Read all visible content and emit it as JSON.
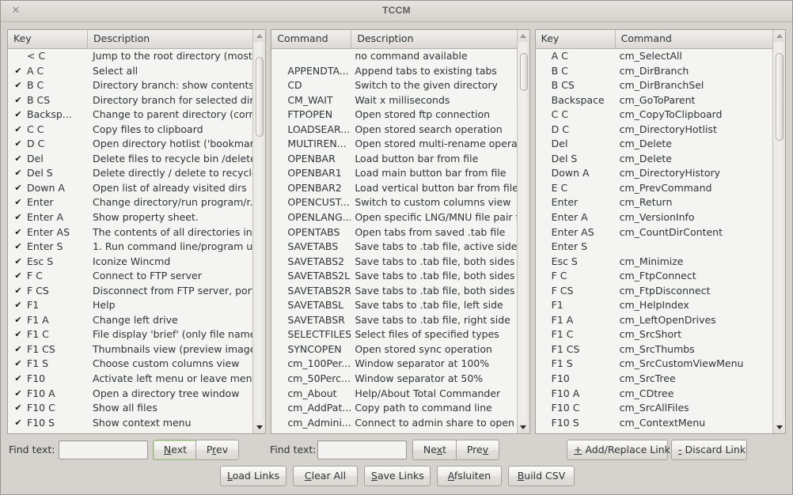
{
  "window": {
    "title": "TCCM",
    "close_icon": "close-icon",
    "close_glyph": "✕"
  },
  "panel_left": {
    "columns": [
      "Key",
      "Description"
    ],
    "scrollbar": {
      "up_icon": "triangle-up-icon",
      "down_icon": "triangle-down-icon",
      "thumb_top_pct": 4,
      "thumb_height_pct": 21
    },
    "rows": [
      {
        "checked": false,
        "key": "< C",
        "desc": "Jump to the root directory (most ..."
      },
      {
        "checked": true,
        "key": "A C",
        "desc": "Select all"
      },
      {
        "checked": true,
        "key": "B C",
        "desc": "Directory branch: show contents ..."
      },
      {
        "checked": true,
        "key": "B CS",
        "desc": "Directory branch for selected dire..."
      },
      {
        "checked": true,
        "key": "Backsp...",
        "desc": "Change to parent directory (corre..."
      },
      {
        "checked": true,
        "key": "C C",
        "desc": "Copy files to clipboard"
      },
      {
        "checked": true,
        "key": "D C",
        "desc": "Open directory hotlist ('bookmark..."
      },
      {
        "checked": true,
        "key": "Del",
        "desc": "Delete files to recycle bin /delete ..."
      },
      {
        "checked": true,
        "key": "Del S",
        "desc": "Delete directly / delete to recycle ..."
      },
      {
        "checked": true,
        "key": "Down A",
        "desc": "Open list of already visited dirs"
      },
      {
        "checked": true,
        "key": "Enter",
        "desc": "Change directory/run program/r..."
      },
      {
        "checked": true,
        "key": "Enter A",
        "desc": "Show property sheet."
      },
      {
        "checked": true,
        "key": "Enter AS",
        "desc": "The contents of all directories in t..."
      },
      {
        "checked": true,
        "key": "Enter S",
        "desc": "1. Run command line/program u..."
      },
      {
        "checked": true,
        "key": "Esc S",
        "desc": "Iconize Wincmd"
      },
      {
        "checked": true,
        "key": "F C",
        "desc": "Connect to FTP server"
      },
      {
        "checked": true,
        "key": "F CS",
        "desc": "Disconnect from FTP server, port ..."
      },
      {
        "checked": true,
        "key": "F1",
        "desc": "Help"
      },
      {
        "checked": true,
        "key": "F1 A",
        "desc": "Change left drive"
      },
      {
        "checked": true,
        "key": "F1 C",
        "desc": "File display 'brief' (only file names)"
      },
      {
        "checked": true,
        "key": "F1 CS",
        "desc": "Thumbnails view (preview images)"
      },
      {
        "checked": true,
        "key": "F1 S",
        "desc": "Choose custom columns view"
      },
      {
        "checked": true,
        "key": "F10",
        "desc": "Activate left menu or leave menu"
      },
      {
        "checked": true,
        "key": "F10 A",
        "desc": "Open a directory tree window"
      },
      {
        "checked": true,
        "key": "F10 C",
        "desc": "Show all files"
      },
      {
        "checked": true,
        "key": "F10 S",
        "desc": "Show context menu"
      }
    ]
  },
  "panel_middle": {
    "columns": [
      "Command",
      "Description"
    ],
    "scrollbar": {
      "up_icon": "triangle-up-icon",
      "down_icon": "triangle-down-icon",
      "thumb_top_pct": 3,
      "thumb_height_pct": 10
    },
    "rows": [
      {
        "cmd": "",
        "desc": "no command available"
      },
      {
        "cmd": "APPENDTA...",
        "desc": "Append tabs to existing tabs"
      },
      {
        "cmd": "CD",
        "desc": "Switch to the given directory"
      },
      {
        "cmd": "CM_WAIT",
        "desc": "Wait x milliseconds"
      },
      {
        "cmd": "FTPOPEN",
        "desc": "Open stored ftp connection"
      },
      {
        "cmd": "LOADSEAR...",
        "desc": "Open stored search operation"
      },
      {
        "cmd": "MULTIREN...",
        "desc": "Open stored multi-rename opera..."
      },
      {
        "cmd": "OPENBAR",
        "desc": "Load button bar from file"
      },
      {
        "cmd": "OPENBAR1",
        "desc": "Load main button bar from file"
      },
      {
        "cmd": "OPENBAR2",
        "desc": "Load vertical button bar from file"
      },
      {
        "cmd": "OPENCUST...",
        "desc": "Switch to custom columns view"
      },
      {
        "cmd": "OPENLANG...",
        "desc": "Open specific LNG/MNU file pair f..."
      },
      {
        "cmd": "OPENTABS",
        "desc": "Open tabs from saved .tab file"
      },
      {
        "cmd": "SAVETABS",
        "desc": "Save tabs to .tab file, active side"
      },
      {
        "cmd": "SAVETABS2",
        "desc": "Save tabs to .tab file, both sides (..."
      },
      {
        "cmd": "SAVETABS2L",
        "desc": "Save tabs to .tab file, both sides (l..."
      },
      {
        "cmd": "SAVETABS2R",
        "desc": "Save tabs to .tab file, both sides (r..."
      },
      {
        "cmd": "SAVETABSL",
        "desc": "Save tabs to .tab file, left side"
      },
      {
        "cmd": "SAVETABSR",
        "desc": "Save tabs to .tab file, right side"
      },
      {
        "cmd": "SELECTFILES",
        "desc": "Select files of specified types"
      },
      {
        "cmd": "SYNCOPEN",
        "desc": "Open stored sync operation"
      },
      {
        "cmd": "cm_100Per...",
        "desc": "Window separator at 100%"
      },
      {
        "cmd": "cm_50Perc...",
        "desc": "Window separator at 50%"
      },
      {
        "cmd": "cm_About",
        "desc": "Help/About Total Commander"
      },
      {
        "cmd": "cm_AddPat...",
        "desc": "Copy path to command line"
      },
      {
        "cmd": "cm_Admini...",
        "desc": "Connect to admin share to open \\"
      }
    ]
  },
  "panel_right": {
    "columns": [
      "Key",
      "Command"
    ],
    "scrollbar": {
      "up_icon": "triangle-up-icon",
      "down_icon": "triangle-down-icon",
      "thumb_top_pct": 3,
      "thumb_height_pct": 23
    },
    "rows": [
      {
        "key": "A C",
        "cmd": "cm_SelectAll"
      },
      {
        "key": "B C",
        "cmd": "cm_DirBranch"
      },
      {
        "key": "B CS",
        "cmd": "cm_DirBranchSel"
      },
      {
        "key": "Backspace",
        "cmd": "cm_GoToParent"
      },
      {
        "key": "C C",
        "cmd": "cm_CopyToClipboard"
      },
      {
        "key": "D C",
        "cmd": "cm_DirectoryHotlist"
      },
      {
        "key": "Del",
        "cmd": "cm_Delete"
      },
      {
        "key": "Del S",
        "cmd": "cm_Delete"
      },
      {
        "key": "Down A",
        "cmd": "cm_DirectoryHistory"
      },
      {
        "key": "E C",
        "cmd": "cm_PrevCommand"
      },
      {
        "key": "Enter",
        "cmd": "cm_Return"
      },
      {
        "key": "Enter A",
        "cmd": "cm_VersionInfo"
      },
      {
        "key": "Enter AS",
        "cmd": "cm_CountDirContent"
      },
      {
        "key": "Enter S",
        "cmd": ""
      },
      {
        "key": "Esc S",
        "cmd": "cm_Minimize"
      },
      {
        "key": "F C",
        "cmd": "cm_FtpConnect"
      },
      {
        "key": "F CS",
        "cmd": "cm_FtpDisconnect"
      },
      {
        "key": "F1",
        "cmd": "cm_HelpIndex"
      },
      {
        "key": "F1 A",
        "cmd": "cm_LeftOpenDrives"
      },
      {
        "key": "F1 C",
        "cmd": "cm_SrcShort"
      },
      {
        "key": "F1 CS",
        "cmd": "cm_SrcThumbs"
      },
      {
        "key": "F1 S",
        "cmd": "cm_SrcCustomViewMenu"
      },
      {
        "key": "F10",
        "cmd": "cm_SrcTree"
      },
      {
        "key": "F10 A",
        "cmd": "cm_CDtree"
      },
      {
        "key": "F10 C",
        "cmd": "cm_SrcAllFiles"
      },
      {
        "key": "F10 S",
        "cmd": "cm_ContextMenu"
      }
    ]
  },
  "toolbar": {
    "find_label_left": "Find text:",
    "find_value_left": "",
    "find_placeholder_left": "",
    "next_left": "Next",
    "prev_left": "Prev",
    "find_label_right": "Find text:",
    "find_value_right": "",
    "find_placeholder_right": "",
    "next_right": "Next",
    "prev_right": "Prev",
    "add_replace_link": "+ Add/Replace Link",
    "discard_link": "- Discard Link",
    "load_links": "Load Links",
    "clear_all": "Clear All",
    "save_links": "Save Links",
    "afsluiten": "Afsluiten",
    "build_csv": "Build CSV"
  },
  "colors": {
    "window_bg": "#d6d2cd",
    "list_bg": "#f4f4f2",
    "header_bg": "#e6e4e1",
    "text": "#2e3436",
    "focus_border": "#9fb08b"
  }
}
